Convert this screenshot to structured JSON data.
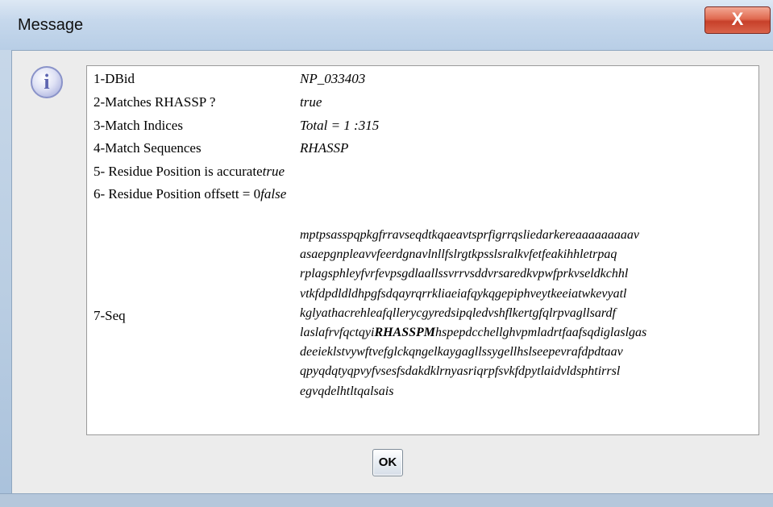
{
  "window": {
    "title": "Message",
    "close_label": "X"
  },
  "icon": {
    "glyph": "i"
  },
  "fields": [
    {
      "label": "1-DBid",
      "value": "NP_033403"
    },
    {
      "label": "2-Matches RHASSP ?",
      "value": "true"
    },
    {
      "label": "3-Match Indices",
      "value": "Total = 1 :315"
    },
    {
      "label": "4-Match Sequences",
      "value": "RHASSP"
    },
    {
      "label": "5- Residue Position is accurate",
      "value": "true"
    },
    {
      "label": "6- Residue Position offsett = 0",
      "value": "false"
    }
  ],
  "sequence": {
    "label": "7-Seq",
    "lines": [
      "mptpsasspqpkgfrravseqdtkqaeavtsprfigrrqsliedarkereaaaaaaaaav",
      "asaepgnpleavvfeerdgnavlnllfslrgtkpsslsralkvfetfeakihhletrpaq",
      "rplagsphleyfvrfevpsgdlaallssvrrvsddvrsaredkvpwfprkvseldkchhl",
      "vtkfdpdldldhpgfsdqayrqrrkliaeiafqykqgepiphveytkeeiatwkevyatl",
      "kglyathacrehleafqllerycgyredsipqledvshflkertgfqlrpvagllsardf",
      "laslafrvfqctqyi",
      "RHASSPM",
      "hspepdcchellghvpmladrtfaafsqdiglaslgas",
      "deeieklstvywftvefglckqngelkaygagllssygellhslseepevrafdpdtaav",
      "qpyqdqtyqpvyfvsesfsdakdklrnyasriqrpfsvkfdpytlaidvldsphtirrsl",
      "egvqdelhtltqalsais"
    ]
  },
  "buttons": {
    "ok": "OK"
  }
}
